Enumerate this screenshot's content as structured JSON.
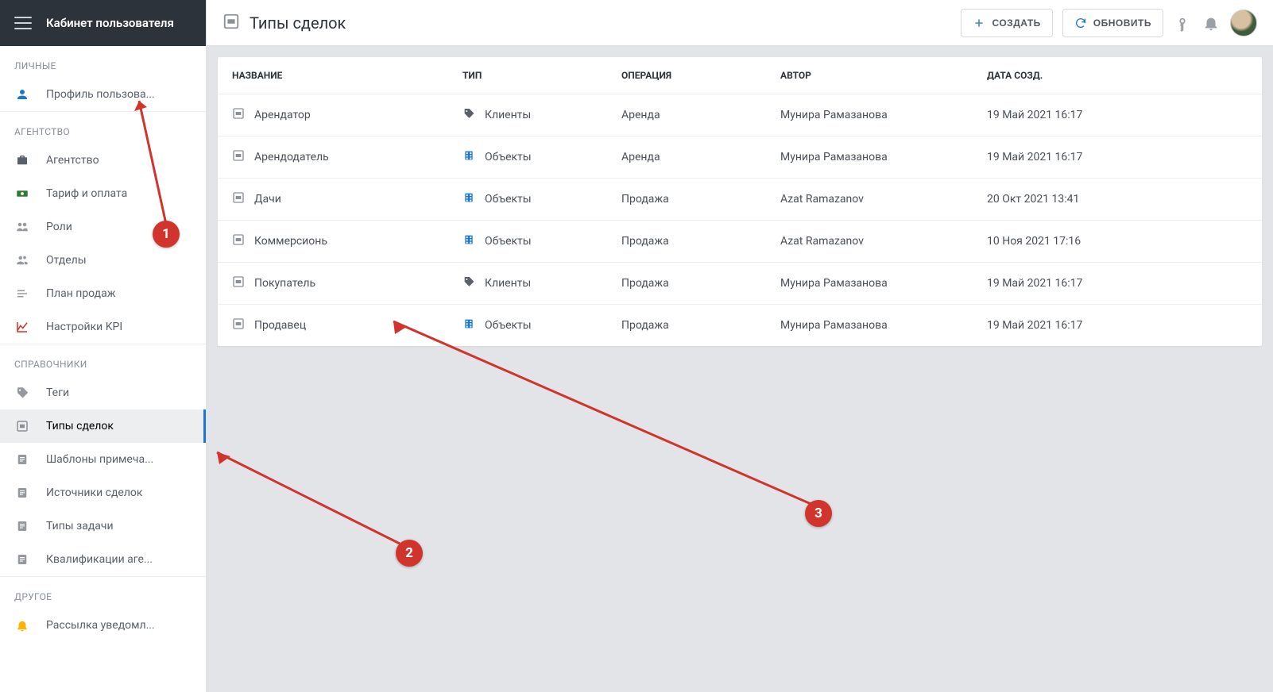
{
  "sidebar": {
    "title": "Кабинет пользователя",
    "sections": [
      {
        "label": "ЛИЧНЫЕ",
        "items": [
          {
            "id": "profile",
            "label": "Профиль пользова...",
            "icon": "person"
          }
        ]
      },
      {
        "label": "АГЕНТСТВО",
        "items": [
          {
            "id": "agency",
            "label": "Агентство",
            "icon": "briefcase"
          },
          {
            "id": "billing",
            "label": "Тариф и оплата",
            "icon": "cash"
          },
          {
            "id": "roles",
            "label": "Роли",
            "icon": "group"
          },
          {
            "id": "depts",
            "label": "Отделы",
            "icon": "people"
          },
          {
            "id": "sales",
            "label": "План продаж",
            "icon": "list"
          },
          {
            "id": "kpi",
            "label": "Настройки KPI",
            "icon": "chart"
          }
        ]
      },
      {
        "label": "СПРАВОЧНИКИ",
        "items": [
          {
            "id": "tags",
            "label": "Теги",
            "icon": "tag"
          },
          {
            "id": "dealtypes",
            "label": "Типы сделок",
            "icon": "deal",
            "active": true
          },
          {
            "id": "notetpl",
            "label": "Шаблоны примеча...",
            "icon": "doc"
          },
          {
            "id": "sources",
            "label": "Источники сделок",
            "icon": "doc"
          },
          {
            "id": "tasktypes",
            "label": "Типы задачи",
            "icon": "doc"
          },
          {
            "id": "qual",
            "label": "Квалификации аге...",
            "icon": "doc"
          }
        ]
      },
      {
        "label": "ДРУГОЕ",
        "items": [
          {
            "id": "mailing",
            "label": "Рассылка уведомл...",
            "icon": "bell"
          }
        ]
      }
    ]
  },
  "header": {
    "page_title": "Типы сделок",
    "create_label": "СОЗДАТЬ",
    "refresh_label": "ОБНОВИТЬ"
  },
  "table": {
    "columns": [
      "НАЗВАНИЕ",
      "ТИП",
      "ОПЕРАЦИЯ",
      "АВТОР",
      "ДАТА СОЗД."
    ],
    "rows": [
      {
        "name": "Арендатор",
        "type": "Клиенты",
        "type_icon": "clients",
        "op": "Аренда",
        "author": "Мунира Рамазанова",
        "created": "19 Май 2021 16:17"
      },
      {
        "name": "Арендодатель",
        "type": "Объекты",
        "type_icon": "objects",
        "op": "Аренда",
        "author": "Мунира Рамазанова",
        "created": "19 Май 2021 16:17"
      },
      {
        "name": "Дачи",
        "type": "Объекты",
        "type_icon": "objects",
        "op": "Продажа",
        "author": "Azat Ramazanov",
        "created": "20 Окт 2021 13:41"
      },
      {
        "name": "Коммерсионь",
        "type": "Объекты",
        "type_icon": "objects",
        "op": "Продажа",
        "author": "Azat Ramazanov",
        "created": "10 Ноя 2021 17:16"
      },
      {
        "name": "Покупатель",
        "type": "Клиенты",
        "type_icon": "clients",
        "op": "Продажа",
        "author": "Мунира Рамазанова",
        "created": "19 Май 2021 16:17"
      },
      {
        "name": "Продавец",
        "type": "Объекты",
        "type_icon": "objects",
        "op": "Продажа",
        "author": "Мунира Рамазанова",
        "created": "19 Май 2021 16:17"
      }
    ]
  },
  "annotations": {
    "badges": [
      "1",
      "2",
      "3"
    ]
  }
}
